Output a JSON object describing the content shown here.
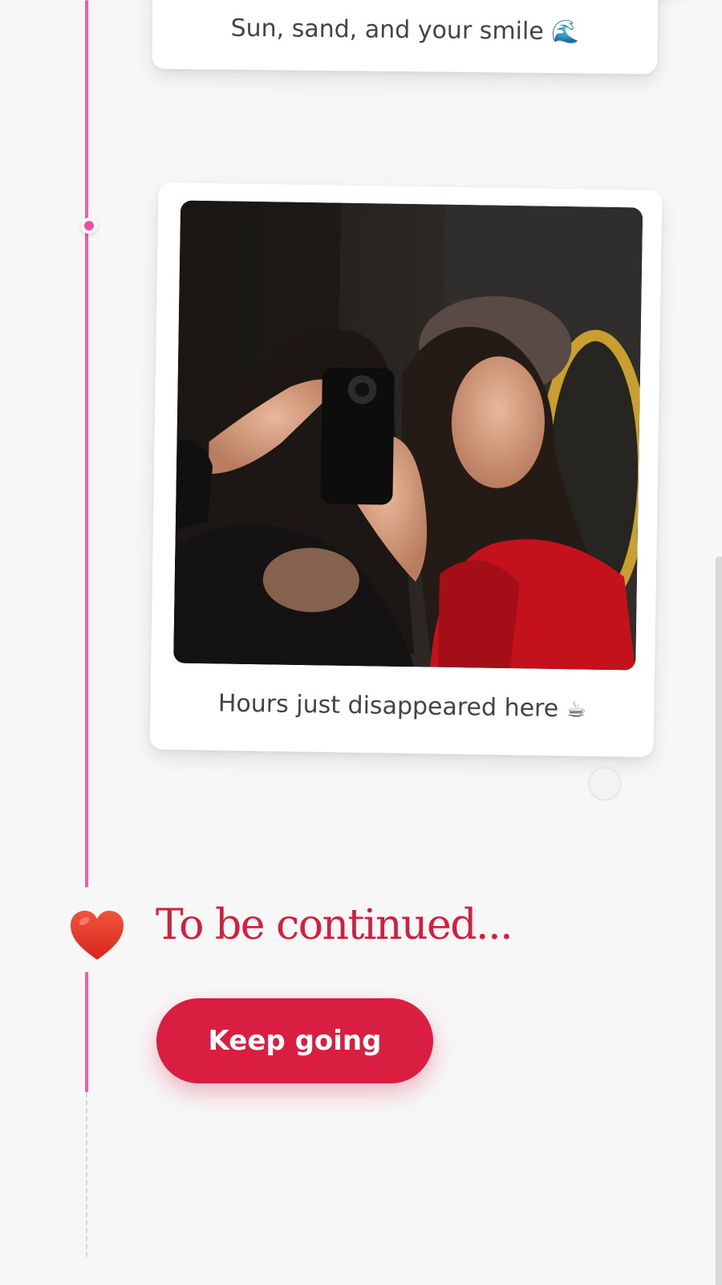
{
  "memories": [
    {
      "caption": "Sun, sand, and your smile",
      "emoji": "🌊"
    },
    {
      "caption": "Hours just disappeared here",
      "emoji": "☕",
      "photo_alt": "Two friends taking a mirror selfie"
    }
  ],
  "ending": {
    "title": "To be continued...",
    "button_label": "Keep going"
  },
  "icons": {
    "heart": "heart-icon",
    "timeline_dot": "timeline-dot"
  },
  "colors": {
    "accent": "#d91e41",
    "timeline": "#ef5ea6",
    "title": "#d1203f",
    "background": "#f7f7f8"
  }
}
